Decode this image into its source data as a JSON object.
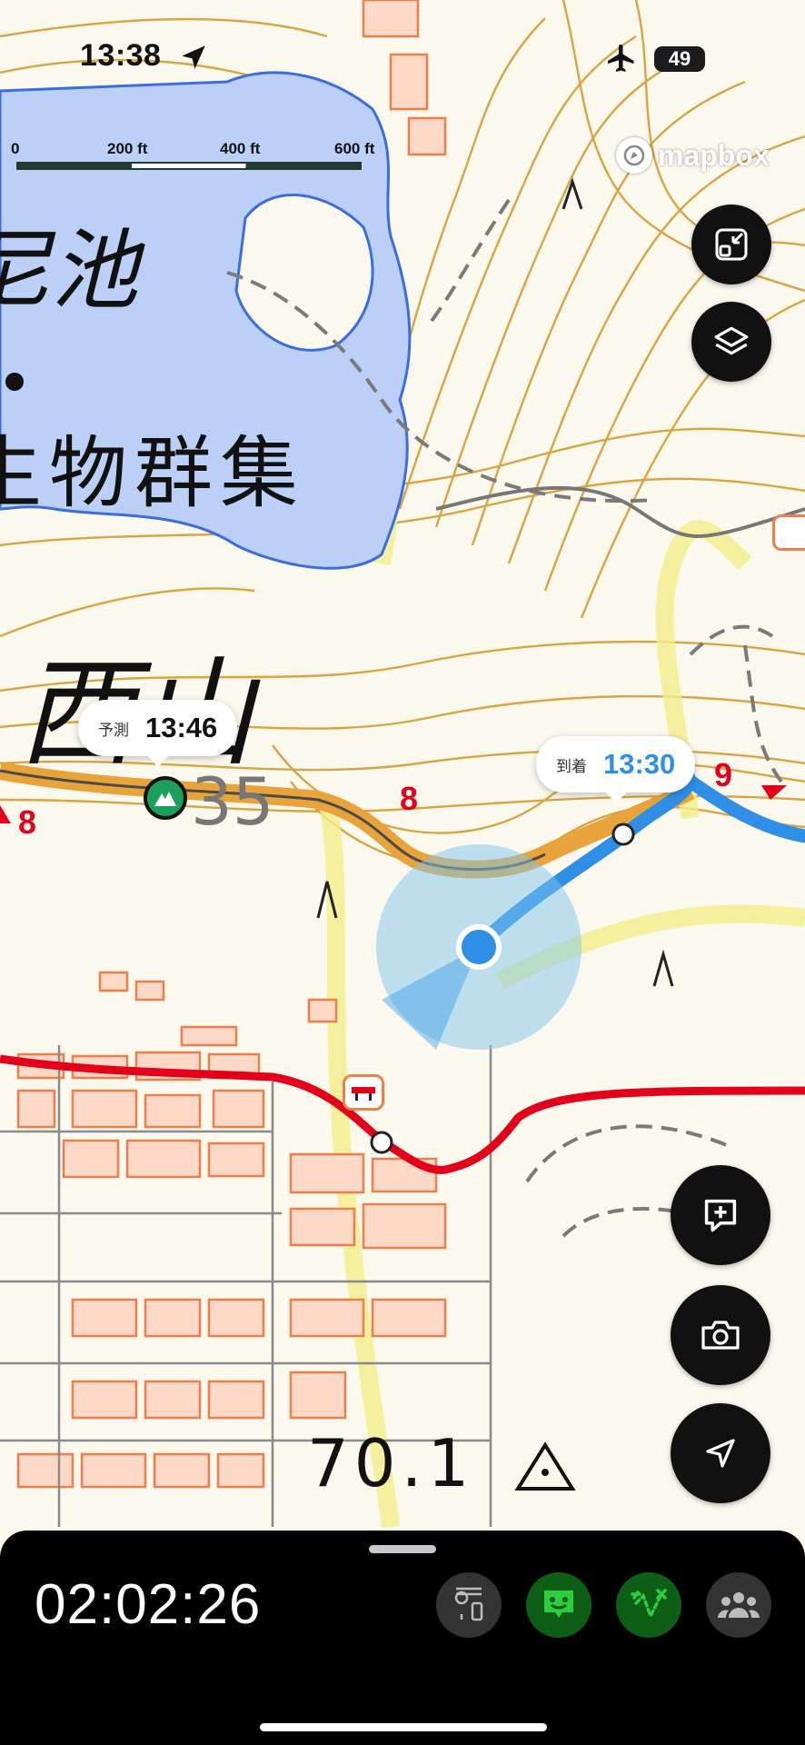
{
  "status_bar": {
    "time": "13:38",
    "battery": "49"
  },
  "scale_bar": {
    "labels": [
      "0",
      "200 ft",
      "400 ft",
      "600 ft"
    ]
  },
  "attribution": {
    "mapbox": "mapbox"
  },
  "map_labels": {
    "pond_name": "尼池",
    "colony": "生物群集",
    "mountain": "西山",
    "elevation_35": "35",
    "elevation_70": "70.1",
    "contour_8a": "8",
    "contour_8b": "8",
    "contour_9": "9"
  },
  "callouts": {
    "predicted": {
      "label": "予測",
      "time": "13:46"
    },
    "arrival": {
      "label": "到着",
      "time": "13:30"
    }
  },
  "bottom_panel": {
    "elapsed_time": "02:02:26"
  },
  "colors": {
    "accent_blue": "#2f8fe6",
    "route_red": "#e3001b",
    "trail_orange": "#e8a43a",
    "water": "#bcd0f7",
    "contour": "#d9a441",
    "building": "#f5a27a",
    "active_green": "#2ecc40"
  },
  "icons": [
    "location-arrow-icon",
    "airplane-icon",
    "compress-icon",
    "layers-icon",
    "add-note-icon",
    "camera-icon",
    "navigate-icon",
    "mountain-marker-icon",
    "pin-distance-icon",
    "face-icon",
    "route-icon",
    "group-icon",
    "gate-icon"
  ]
}
